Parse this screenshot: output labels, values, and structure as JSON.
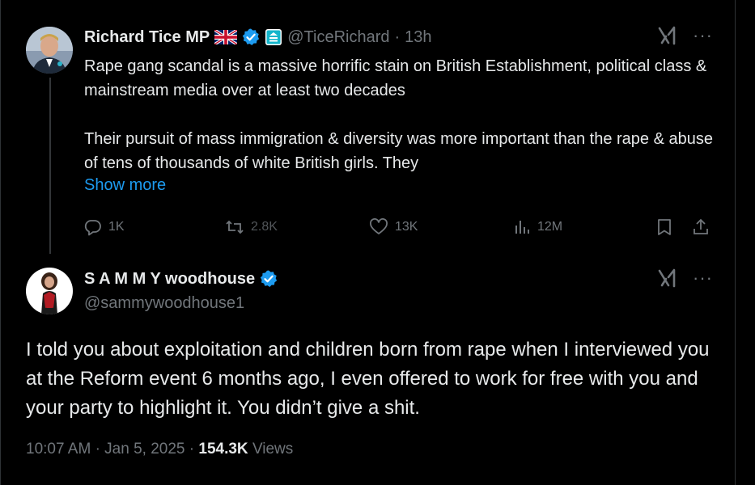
{
  "tweet1": {
    "display_name": "Richard Tice MP",
    "handle": "@TiceRichard",
    "time": "13h",
    "text_p1": "Rape gang scandal is a massive horrific stain on British Establishment, political class & mainstream media over at least two decades",
    "text_p2": "Their pursuit of mass immigration & diversity was more important than the rape & abuse of tens of thousands of white British girls. They",
    "show_more": "Show more",
    "replies": "1K",
    "reposts": "2.8K",
    "likes": "13K",
    "views": "12M",
    "icons": {
      "flag": "uk-flag-icon",
      "verified": "verified-badge-icon",
      "affiliate": "affiliate-badge-icon"
    }
  },
  "tweet2": {
    "display_name": "S A M M Y woodhouse",
    "handle": "@sammywoodhouse1",
    "text": "I told you about exploitation and children born from rape when I interviewed you at the Reform event 6 months ago, I even offered to work for free with you and your party to highlight it. You didn’t give a shit.",
    "time": "10:07 AM",
    "date": "Jan 5, 2025",
    "views_count": "154.3K",
    "views_label": "Views"
  },
  "separator": "·",
  "menu_glyph": "···",
  "colors": {
    "background": "#000000",
    "text": "#e7e9ea",
    "muted": "#71767b",
    "accent": "#1d9bf0"
  }
}
